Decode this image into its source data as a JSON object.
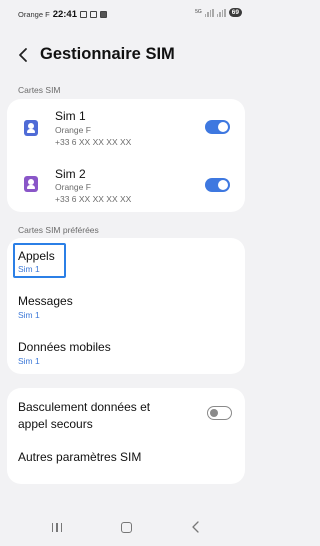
{
  "status_bar": {
    "carrier": "Orange F",
    "time": "22:41",
    "network": "5G",
    "battery": "69"
  },
  "header": {
    "title": "Gestionnaire SIM"
  },
  "sim_cards": {
    "label": "Cartes SIM",
    "items": [
      {
        "name": "Sim 1",
        "carrier": "Orange F",
        "number": "+33 6 XX XX XX XX",
        "enabled": true,
        "icon_color": "#4f6bd6"
      },
      {
        "name": "Sim 2",
        "carrier": "Orange F",
        "number": "+33 6 XX XX XX XX",
        "enabled": true,
        "icon_color": "#8a56c8"
      }
    ]
  },
  "preferred": {
    "label": "Cartes SIM préférées",
    "items": [
      {
        "title": "Appels",
        "value": "Sim 1"
      },
      {
        "title": "Messages",
        "value": "Sim 1"
      },
      {
        "title": "Données mobiles",
        "value": "Sim 1"
      }
    ]
  },
  "other": {
    "backup_switch_label": "Basculement données et appel secours",
    "backup_switch_enabled": false,
    "more_settings_label": "Autres paramètres SIM"
  },
  "colors": {
    "accent": "#3e78e0",
    "focus": "#2b7fe6"
  }
}
